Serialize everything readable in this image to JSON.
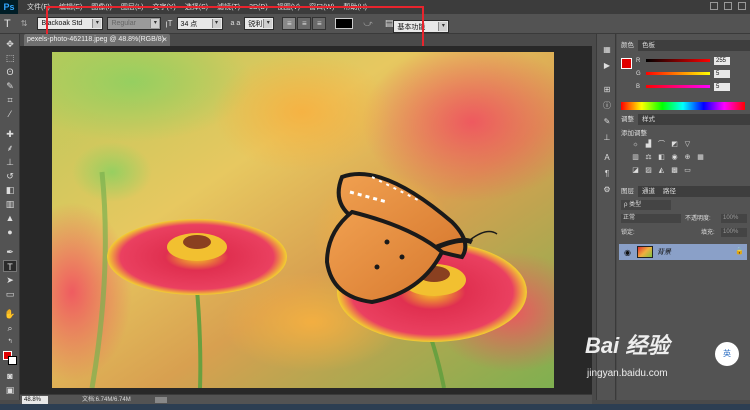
{
  "app": {
    "logo": "Ps",
    "menus": [
      "文件(F)",
      "编辑(E)",
      "图像(I)",
      "图层(L)",
      "文字(Y)",
      "选择(S)",
      "滤镜(T)",
      "3D(D)",
      "视图(V)",
      "窗口(W)",
      "帮助(H)"
    ]
  },
  "options": {
    "tool_icon": "T",
    "font_family": "Blackoak Std",
    "font_style": "Regular",
    "font_size": "34 点",
    "aa_label": "a a",
    "aa_mode": "锐利",
    "text_color": "#000000",
    "workspace": "基本功能"
  },
  "document": {
    "tab_title": "pexels-photo-462118.jpeg @ 48.8%(RGB/8)",
    "close_glyph": "×"
  },
  "status": {
    "zoom": "48.8%",
    "doc_size": "文档:6.74M/6.74M"
  },
  "panels": {
    "color_tabs": [
      "颜色",
      "色板"
    ],
    "channels": [
      {
        "label": "R",
        "value": "255"
      },
      {
        "label": "G",
        "value": "5"
      },
      {
        "label": "B",
        "value": "5"
      }
    ],
    "adjust_tabs": [
      "调整",
      "样式"
    ],
    "adjust_title": "添加调整",
    "layers_tabs": [
      "图层",
      "通道",
      "路径"
    ],
    "layers_filter": "ρ 类型",
    "blend_mode": "正常",
    "opacity_label": "不透明度:",
    "opacity_value": "100%",
    "lock_label": "锁定:",
    "fill_label": "填充:",
    "fill_value": "100%",
    "layer_name": "背景"
  },
  "watermark": {
    "main": "Bai 经验",
    "sub": "jingyan.baidu.com",
    "badge": "英"
  },
  "colors": {
    "foreground": "#e00000",
    "background": "#ffffff",
    "highlight": "#e8242d"
  }
}
